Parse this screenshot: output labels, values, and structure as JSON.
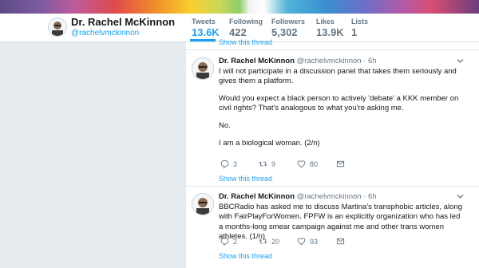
{
  "profile": {
    "name": "Dr. Rachel McKinnon",
    "handle": "@rachelvmckinnon"
  },
  "stats": [
    {
      "label": "Tweets",
      "value": "13.6K"
    },
    {
      "label": "Following",
      "value": "422"
    },
    {
      "label": "Followers",
      "value": "5,302"
    },
    {
      "label": "Likes",
      "value": "13.9K"
    },
    {
      "label": "Lists",
      "value": "1"
    }
  ],
  "colors": {
    "accent": "#1da1f2",
    "background": "#e6ecf0"
  },
  "timeline": {
    "show_thread_label": "Show this thread",
    "tweets": [
      {
        "author": "Dr. Rachel McKinnon",
        "handle": "@rachelvmckinnon",
        "time": "6h",
        "paragraphs": [
          "I will not participate in a discussion panel that takes them seriously and gives them a platform.",
          "Would you expect a black person to actively 'debate' a KKK member on civil rights? That's analogous to what you're asking me.",
          "No.",
          "I am a biological woman. (2/n)"
        ],
        "replies": "3",
        "retweets": "9",
        "likes": "80"
      },
      {
        "author": "Dr. Rachel McKinnon",
        "handle": "@rachelvmckinnon",
        "time": "6h",
        "paragraphs": [
          "BBCRadio has asked me to discuss Martina's transphobic articles, along with FairPlayForWomen. FPFW is an explicitly organization who has led a months-long smear campaign against me and other trans women athletes. (1/n)"
        ],
        "replies": "2",
        "retweets": "20",
        "likes": "93"
      }
    ]
  }
}
